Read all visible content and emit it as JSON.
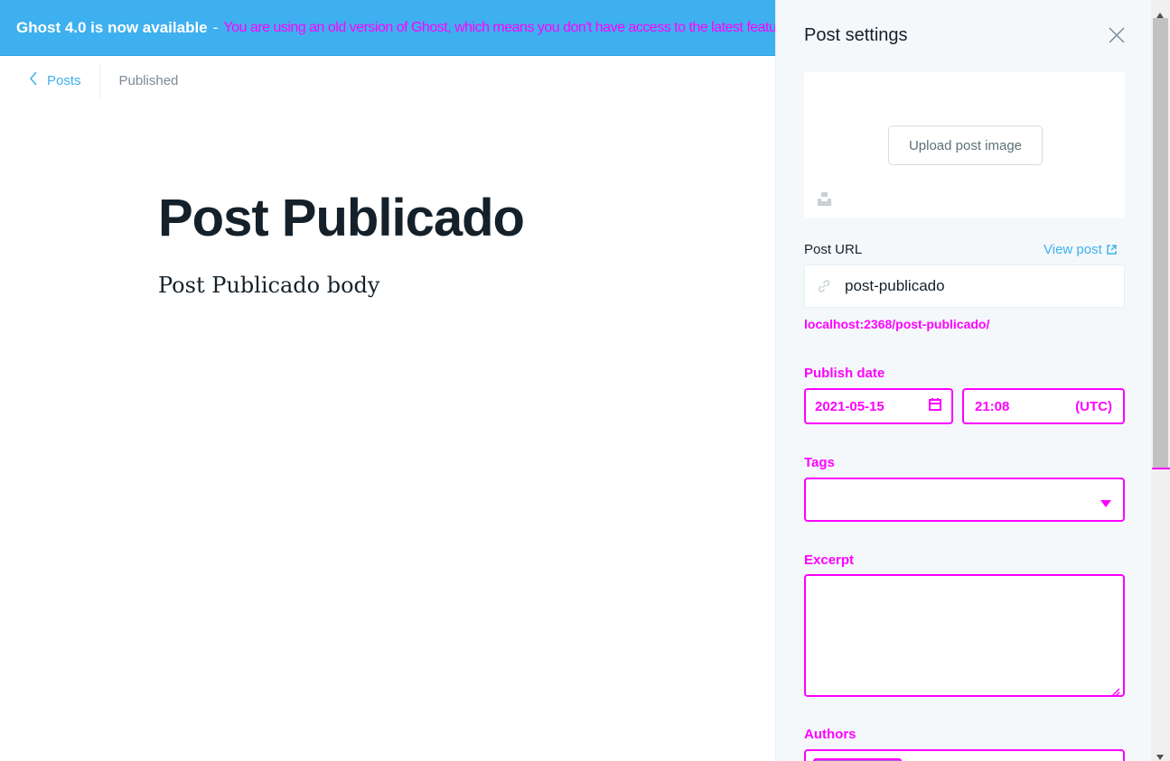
{
  "banner": {
    "title": "Ghost 4.0 is now available",
    "separator": "-",
    "message": "You are using an old version of Ghost, which means you don't have access to the latest features."
  },
  "editor": {
    "back_label": "Posts",
    "status": "Published",
    "post_title": "Post Publicado",
    "post_body": "Post Publicado body"
  },
  "settings": {
    "title": "Post settings",
    "upload_label": "Upload post image",
    "post_url_label": "Post URL",
    "view_post_label": "View post",
    "slug": "post-publicado",
    "url_preview": "localhost:2368/post-publicado/",
    "publish_date_label": "Publish date",
    "date_value": "2021-05-15",
    "time_value": "21:08",
    "timezone": "(UTC)",
    "tags_label": "Tags",
    "excerpt_label": "Excerpt",
    "authors_label": "Authors"
  },
  "colors": {
    "accent": "#3eb0ef",
    "highlight": "#ff00ff"
  }
}
